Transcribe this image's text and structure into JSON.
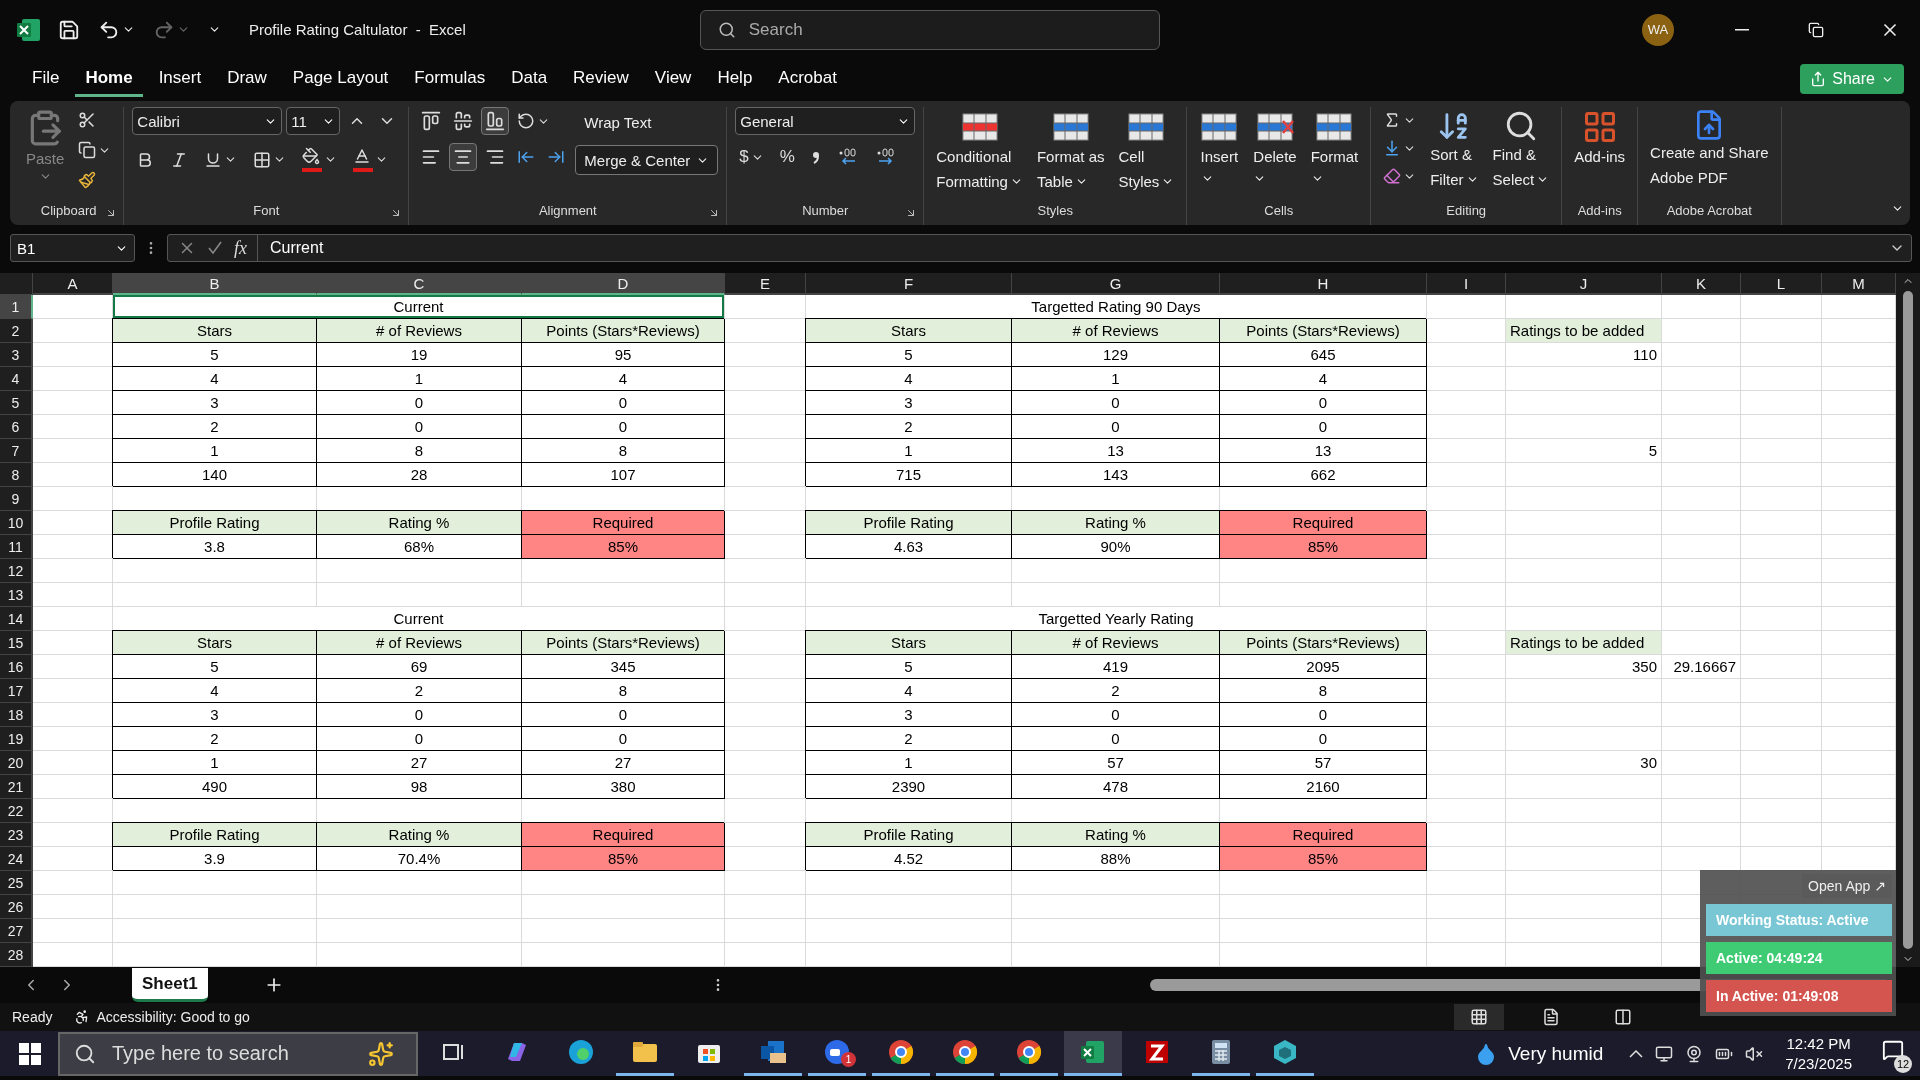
{
  "title_bar": {
    "title": "Profile Rating Caltulator  -  Excel",
    "search_placeholder": "Search",
    "avatar": "WA"
  },
  "menu": [
    {
      "label": "File",
      "selected": false
    },
    {
      "label": "Home",
      "selected": true
    },
    {
      "label": "Insert",
      "selected": false
    },
    {
      "label": "Draw",
      "selected": false
    },
    {
      "label": "Page Layout",
      "selected": false
    },
    {
      "label": "Formulas",
      "selected": false
    },
    {
      "label": "Data",
      "selected": false
    },
    {
      "label": "Review",
      "selected": false
    },
    {
      "label": "View",
      "selected": false
    },
    {
      "label": "Help",
      "selected": false
    },
    {
      "label": "Acrobat",
      "selected": false
    }
  ],
  "share": "Share",
  "ribbon": {
    "groups": [
      {
        "kind": "clipboard",
        "label": "Clipboard",
        "paste": "Paste",
        "launcher": true
      },
      {
        "kind": "font",
        "label": "Font",
        "font": "Calibri",
        "size": "11",
        "launcher": true
      },
      {
        "kind": "alignment",
        "label": "Alignment",
        "wrap": "Wrap Text",
        "merge": "Merge & Center",
        "launcher": true,
        "vertical": [
          {
            "selected": false
          },
          {
            "selected": false
          },
          {
            "selected": true
          }
        ],
        "horizontal": [
          {
            "selected": false
          },
          {
            "selected": true
          },
          {
            "selected": false
          }
        ]
      },
      {
        "kind": "number",
        "label": "Number",
        "format": "General",
        "currency": "$",
        "percent": "%",
        "launcher": true
      },
      {
        "kind": "large",
        "label": "Styles",
        "buttons": [
          {
            "kind": "conditional",
            "lines": [
              "Conditional",
              "Formatting"
            ]
          },
          {
            "kind": "format-table",
            "lines": [
              "Format as",
              "Table"
            ]
          },
          {
            "kind": "cell-styles",
            "lines": [
              "Cell",
              "Styles"
            ]
          }
        ]
      },
      {
        "kind": "large",
        "label": "Cells",
        "buttons": [
          {
            "kind": "insert",
            "lines": [
              "Insert"
            ]
          },
          {
            "kind": "delete",
            "lines": [
              "Delete"
            ]
          },
          {
            "kind": "format",
            "lines": [
              "Format"
            ]
          }
        ]
      },
      {
        "kind": "editing",
        "label": "Editing",
        "buttons": [
          {
            "kind": "sort",
            "lines": [
              "Sort &",
              "Filter"
            ]
          },
          {
            "kind": "find",
            "lines": [
              "Find &",
              "Select"
            ]
          }
        ]
      },
      {
        "kind": "large",
        "label": "Add-ins",
        "buttons": [
          {
            "kind": "addins",
            "lines": [
              "Add-ins"
            ]
          }
        ]
      },
      {
        "kind": "large",
        "label": "Adobe Acrobat",
        "buttons": [
          {
            "kind": "acrobat",
            "lines": [
              "Create and Share",
              "Adobe PDF"
            ]
          }
        ]
      }
    ]
  },
  "formula_bar": {
    "name_box": "B1",
    "fx": "fx",
    "formula": "Current"
  },
  "sheet": {
    "columns": [
      {
        "label": "A",
        "selected": false
      },
      {
        "label": "B",
        "selected": true
      },
      {
        "label": "C",
        "selected": true
      },
      {
        "label": "D",
        "selected": true
      },
      {
        "label": "E",
        "selected": false
      },
      {
        "label": "F",
        "selected": false
      },
      {
        "label": "G",
        "selected": false
      },
      {
        "label": "H",
        "selected": false
      },
      {
        "label": "I",
        "selected": false
      },
      {
        "label": "J",
        "selected": false
      },
      {
        "label": "K",
        "selected": false
      },
      {
        "label": "L",
        "selected": false
      },
      {
        "label": "M",
        "selected": false
      }
    ],
    "rows": [
      {
        "label": "1",
        "selected": true
      },
      {
        "label": "2",
        "selected": false
      },
      {
        "label": "3",
        "selected": false
      },
      {
        "label": "4",
        "selected": false
      },
      {
        "label": "5",
        "selected": false
      },
      {
        "label": "6",
        "selected": false
      },
      {
        "label": "7",
        "selected": false
      },
      {
        "label": "8",
        "selected": false
      },
      {
        "label": "9",
        "selected": false
      },
      {
        "label": "10",
        "selected": false
      },
      {
        "label": "11",
        "selected": false
      },
      {
        "label": "12",
        "selected": false
      },
      {
        "label": "13",
        "selected": false
      },
      {
        "label": "14",
        "selected": false
      },
      {
        "label": "15",
        "selected": false
      },
      {
        "label": "16",
        "selected": false
      },
      {
        "label": "17",
        "selected": false
      },
      {
        "label": "18",
        "selected": false
      },
      {
        "label": "19",
        "selected": false
      },
      {
        "label": "20",
        "selected": false
      },
      {
        "label": "21",
        "selected": false
      },
      {
        "label": "22",
        "selected": false
      },
      {
        "label": "23",
        "selected": false
      },
      {
        "label": "24",
        "selected": false
      },
      {
        "label": "25",
        "selected": false
      },
      {
        "label": "26",
        "selected": false
      },
      {
        "label": "27",
        "selected": false
      },
      {
        "label": "28",
        "selected": false
      }
    ],
    "tables": [
      {
        "title": "Current",
        "title_selected": true,
        "columns": [
          "Stars",
          "# of Reviews",
          "Points (Stars*Reviews)"
        ],
        "rows": [
          [
            "5",
            "19",
            "95"
          ],
          [
            "4",
            "1",
            "4"
          ],
          [
            "3",
            "0",
            "0"
          ],
          [
            "2",
            "0",
            "0"
          ],
          [
            "1",
            "8",
            "8"
          ],
          [
            "140",
            "28",
            "107"
          ]
        ],
        "summary": [
          {
            "label": "Profile Rating",
            "value": "3.8",
            "kind": "plain"
          },
          {
            "label": "Rating %",
            "value": "68%",
            "kind": "plain"
          },
          {
            "label": "Required",
            "value": "85%",
            "kind": "required"
          }
        ]
      },
      {
        "title": "Targetted Rating 90 Days",
        "title_selected": false,
        "columns": [
          "Stars",
          "# of Reviews",
          "Points (Stars*Reviews)"
        ],
        "rows": [
          [
            "5",
            "129",
            "645"
          ],
          [
            "4",
            "1",
            "4"
          ],
          [
            "3",
            "0",
            "0"
          ],
          [
            "2",
            "0",
            "0"
          ],
          [
            "1",
            "13",
            "13"
          ],
          [
            "715",
            "143",
            "662"
          ]
        ],
        "summary": [
          {
            "label": "Profile Rating",
            "value": "4.63",
            "kind": "plain"
          },
          {
            "label": "Rating %",
            "value": "90%",
            "kind": "plain"
          },
          {
            "label": "Required",
            "value": "85%",
            "kind": "required"
          }
        ]
      },
      {
        "title": "Current",
        "title_selected": false,
        "columns": [
          "Stars",
          "# of Reviews",
          "Points (Stars*Reviews)"
        ],
        "rows": [
          [
            "5",
            "69",
            "345"
          ],
          [
            "4",
            "2",
            "8"
          ],
          [
            "3",
            "0",
            "0"
          ],
          [
            "2",
            "0",
            "0"
          ],
          [
            "1",
            "27",
            "27"
          ],
          [
            "490",
            "98",
            "380"
          ]
        ],
        "summary": [
          {
            "label": "Profile Rating",
            "value": "3.9",
            "kind": "plain"
          },
          {
            "label": "Rating %",
            "value": "70.4%",
            "kind": "plain"
          },
          {
            "label": "Required",
            "value": "85%",
            "kind": "required"
          }
        ]
      },
      {
        "title": "Targetted Yearly Rating",
        "title_selected": false,
        "columns": [
          "Stars",
          "# of Reviews",
          "Points (Stars*Reviews)"
        ],
        "rows": [
          [
            "5",
            "419",
            "2095"
          ],
          [
            "4",
            "2",
            "8"
          ],
          [
            "3",
            "0",
            "0"
          ],
          [
            "2",
            "0",
            "0"
          ],
          [
            "1",
            "57",
            "57"
          ],
          [
            "2390",
            "478",
            "2160"
          ]
        ],
        "summary": [
          {
            "label": "Profile Rating",
            "value": "4.52",
            "kind": "plain"
          },
          {
            "label": "Rating %",
            "value": "88%",
            "kind": "plain"
          },
          {
            "label": "Required",
            "value": "85%",
            "kind": "required"
          }
        ]
      }
    ],
    "side_notes": [
      {
        "label": "Ratings to be added",
        "top_value": "110",
        "bottom_value": "5"
      },
      {
        "label": "Ratings to be added",
        "top_value": "350",
        "note": "29.16667",
        "bottom_value": "30"
      }
    ]
  },
  "sheet_tabs": [
    {
      "label": "Sheet1",
      "selected": true
    }
  ],
  "status_bar": {
    "ready": "Ready",
    "accessibility": "Accessibility: Good to go"
  },
  "widget": {
    "open_app": "Open App ↗",
    "rows": [
      {
        "text": "Working Status: Active",
        "color": "#79c7d4"
      },
      {
        "text": "Active: 04:49:24",
        "color": "#3ecb74"
      },
      {
        "text": "In Active: 01:49:08",
        "color": "#d4544f"
      }
    ]
  },
  "taskbar": {
    "search_placeholder": "Type here to search",
    "apps": [
      {
        "kind": "task-view",
        "running": false,
        "selected": false
      },
      {
        "kind": "copilot",
        "running": false,
        "selected": false
      },
      {
        "kind": "edge",
        "running": false,
        "selected": false
      },
      {
        "kind": "explorer",
        "running": true,
        "selected": false
      },
      {
        "kind": "store",
        "running": false,
        "selected": false
      },
      {
        "kind": "outlook",
        "running": true,
        "selected": false
      },
      {
        "kind": "zoom",
        "running": true,
        "selected": false,
        "badge": "1"
      },
      {
        "kind": "chrome",
        "running": true,
        "selected": false
      },
      {
        "kind": "chrome",
        "running": true,
        "selected": false
      },
      {
        "kind": "chrome",
        "running": true,
        "selected": false
      },
      {
        "kind": "excel",
        "running": true,
        "selected": true
      },
      {
        "kind": "filezilla",
        "running": false,
        "selected": false
      },
      {
        "kind": "calculator",
        "running": true,
        "selected": false
      },
      {
        "kind": "cube",
        "running": true,
        "selected": false
      }
    ],
    "weather": "Very humid",
    "time": "12:42 PM",
    "date": "7/23/2025",
    "notifications": "12"
  }
}
